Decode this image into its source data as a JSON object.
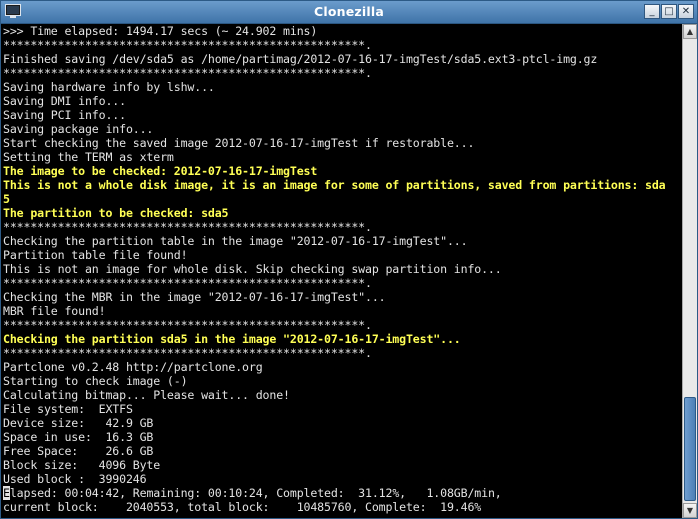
{
  "window": {
    "title": "Clonezilla",
    "app_icon": "terminal-icon",
    "minimize_symbol": "_",
    "maximize_symbol": "□",
    "close_symbol": "✕"
  },
  "terminal": {
    "lines": [
      {
        "text": ">>> Time elapsed: 1494.17 secs (~ 24.902 mins)",
        "highlight": false
      },
      {
        "text": "*****************************************************.",
        "highlight": false
      },
      {
        "text": "Finished saving /dev/sda5 as /home/partimag/2012-07-16-17-imgTest/sda5.ext3-ptcl-img.gz",
        "highlight": false
      },
      {
        "text": "*****************************************************.",
        "highlight": false
      },
      {
        "text": "Saving hardware info by lshw...",
        "highlight": false
      },
      {
        "text": "Saving DMI info...",
        "highlight": false
      },
      {
        "text": "Saving PCI info...",
        "highlight": false
      },
      {
        "text": "Saving package info...",
        "highlight": false
      },
      {
        "text": "Start checking the saved image 2012-07-16-17-imgTest if restorable...",
        "highlight": false
      },
      {
        "text": "Setting the TERM as xterm",
        "highlight": false
      },
      {
        "text": "The image to be checked: 2012-07-16-17-imgTest",
        "highlight": true
      },
      {
        "text": "This is not a whole disk image, it is an image for some of partitions, saved from partitions: sda",
        "highlight": true
      },
      {
        "text": "5",
        "highlight": true
      },
      {
        "text": "The partition to be checked: sda5",
        "highlight": true
      },
      {
        "text": "*****************************************************.",
        "highlight": false
      },
      {
        "text": "Checking the partition table in the image \"2012-07-16-17-imgTest\"...",
        "highlight": false
      },
      {
        "text": "Partition table file found!",
        "highlight": false
      },
      {
        "text": "This is not an image for whole disk. Skip checking swap partition info...",
        "highlight": false
      },
      {
        "text": "*****************************************************.",
        "highlight": false
      },
      {
        "text": "Checking the MBR in the image \"2012-07-16-17-imgTest\"...",
        "highlight": false
      },
      {
        "text": "MBR file found!",
        "highlight": false
      },
      {
        "text": "*****************************************************.",
        "highlight": false
      },
      {
        "text": "Checking the partition sda5 in the image \"2012-07-16-17-imgTest\"...",
        "highlight": true
      },
      {
        "text": "*****************************************************.",
        "highlight": false
      },
      {
        "text": "Partclone v0.2.48 http://partclone.org",
        "highlight": false
      },
      {
        "text": "Starting to check image (-)",
        "highlight": false
      },
      {
        "text": "Calculating bitmap... Please wait... done!",
        "highlight": false
      },
      {
        "text": "File system:  EXTFS",
        "highlight": false
      },
      {
        "text": "Device size:   42.9 GB",
        "highlight": false
      },
      {
        "text": "Space in use:  16.3 GB",
        "highlight": false
      },
      {
        "text": "Free Space:    26.6 GB",
        "highlight": false
      },
      {
        "text": "Block size:   4096 Byte",
        "highlight": false
      },
      {
        "text": "Used block :  3990246",
        "highlight": false
      }
    ],
    "status_line_cursor_char": "E",
    "status_line_rest": "lapsed: 00:04:42, Remaining: 00:10:24, Completed:  31.12%,   1.08GB/min,",
    "last_line": "current block:    2040553, total block:    10485760, Complete:  19.46%"
  },
  "scrollbar": {
    "up_arrow": "▲",
    "down_arrow": "▼"
  }
}
